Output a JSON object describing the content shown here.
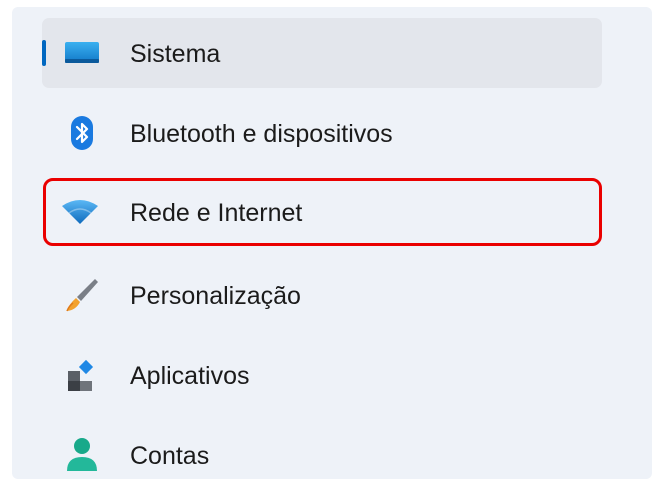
{
  "sidebar": {
    "items": [
      {
        "label": "Sistema",
        "icon": "system-display-icon",
        "selected": true
      },
      {
        "label": "Bluetooth e dispositivos",
        "icon": "bluetooth-icon"
      },
      {
        "label": "Rede e Internet",
        "icon": "wifi-icon",
        "highlighted": true
      },
      {
        "label": "Personalização",
        "icon": "paintbrush-icon"
      },
      {
        "label": "Aplicativos",
        "icon": "apps-icon"
      },
      {
        "label": "Contas",
        "icon": "person-icon"
      }
    ]
  },
  "colors": {
    "panel_background": "#eef2f8",
    "selected_background": "#e3e6ec",
    "accent": "#0067c0",
    "highlight_border": "#ea0000"
  }
}
